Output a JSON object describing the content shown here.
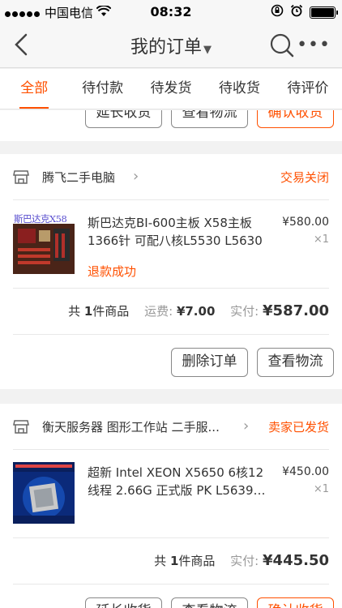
{
  "status_bar": {
    "carrier": "中国电信",
    "time": "08:32"
  },
  "nav": {
    "title": "我的订单"
  },
  "tabs": [
    "全部",
    "待付款",
    "待发货",
    "待收货",
    "待评价"
  ],
  "top_partial_buttons": [
    "延长收货",
    "查看物流",
    "确认收货"
  ],
  "orders": [
    {
      "shop_name": "腾飞二手电脑",
      "status": "交易关闭",
      "thumb_label": "斯巴达克X58",
      "title": "斯巴达克BI-600主板 X58主板 1366针 可配八核L5530 L5630",
      "price": "¥580.00",
      "qty": "×1",
      "refund": "退款成功",
      "summary": {
        "count_prefix": "共",
        "count": "1",
        "count_suffix": "件商品",
        "shipping_label": "运费:",
        "shipping": "¥7.00",
        "paid_label": "实付:",
        "paid": "¥587.00"
      },
      "buttons": [
        "删除订单",
        "查看物流"
      ]
    },
    {
      "shop_name": "衡天服务器 图形工作站 二手服...",
      "status": "卖家已发货",
      "title": "超新 Intel XEON X5650 6核12线程 2.66G 正式版 PK L5639…",
      "price": "¥450.00",
      "qty": "×1",
      "summary": {
        "count_prefix": "共",
        "count": "1",
        "count_suffix": "件商品",
        "paid_label": "实付:",
        "paid": "¥445.50"
      },
      "buttons": [
        "延长收货",
        "查看物流",
        "确认收货"
      ]
    }
  ],
  "colors": {
    "accent": "#ff5000"
  }
}
